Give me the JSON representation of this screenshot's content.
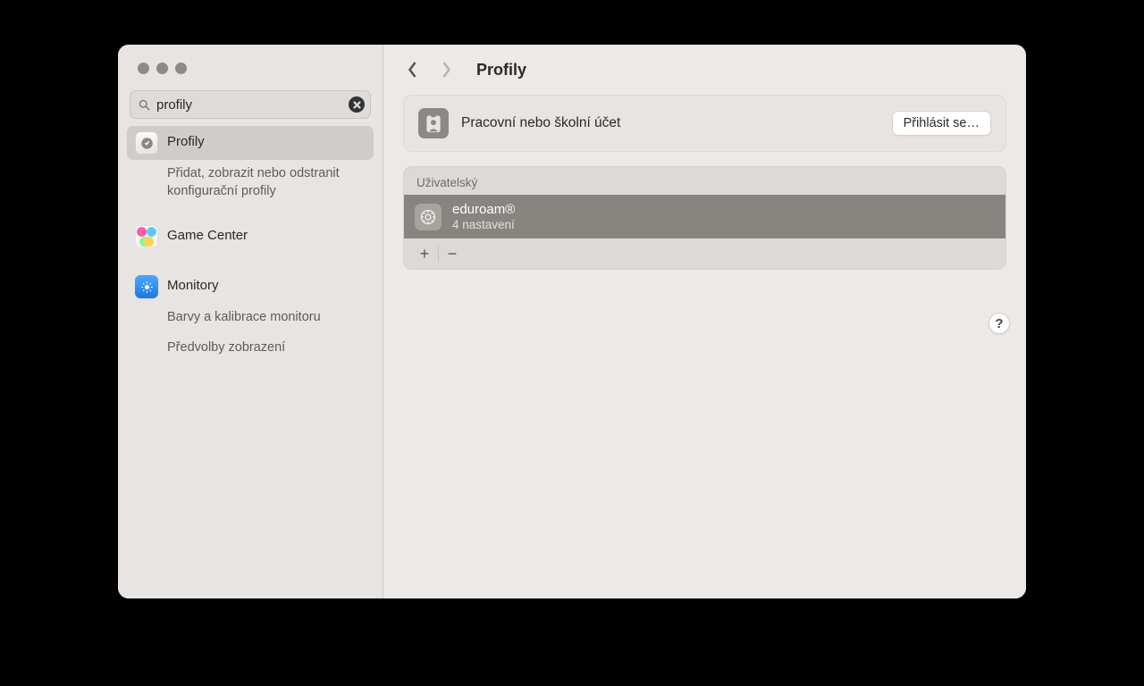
{
  "search": {
    "value": "profily"
  },
  "sidebar": {
    "items": [
      {
        "label": "Profily",
        "sub": "Přidat, zobrazit nebo odstranit konfigurační profily"
      },
      {
        "label": "Game Center"
      },
      {
        "label": "Monitory",
        "subs": [
          "Barvy a kalibrace monitoru",
          "Předvolby zobrazení"
        ]
      }
    ]
  },
  "header": {
    "title": "Profily"
  },
  "account_card": {
    "label": "Pracovní nebo školní účet",
    "button": "Přihlásit se…"
  },
  "profiles_list": {
    "section": "Uživatelský",
    "rows": [
      {
        "name": "eduroam®",
        "detail": "4 nastavení"
      }
    ]
  },
  "icons": {
    "plus": "+",
    "minus": "−",
    "help": "?"
  }
}
